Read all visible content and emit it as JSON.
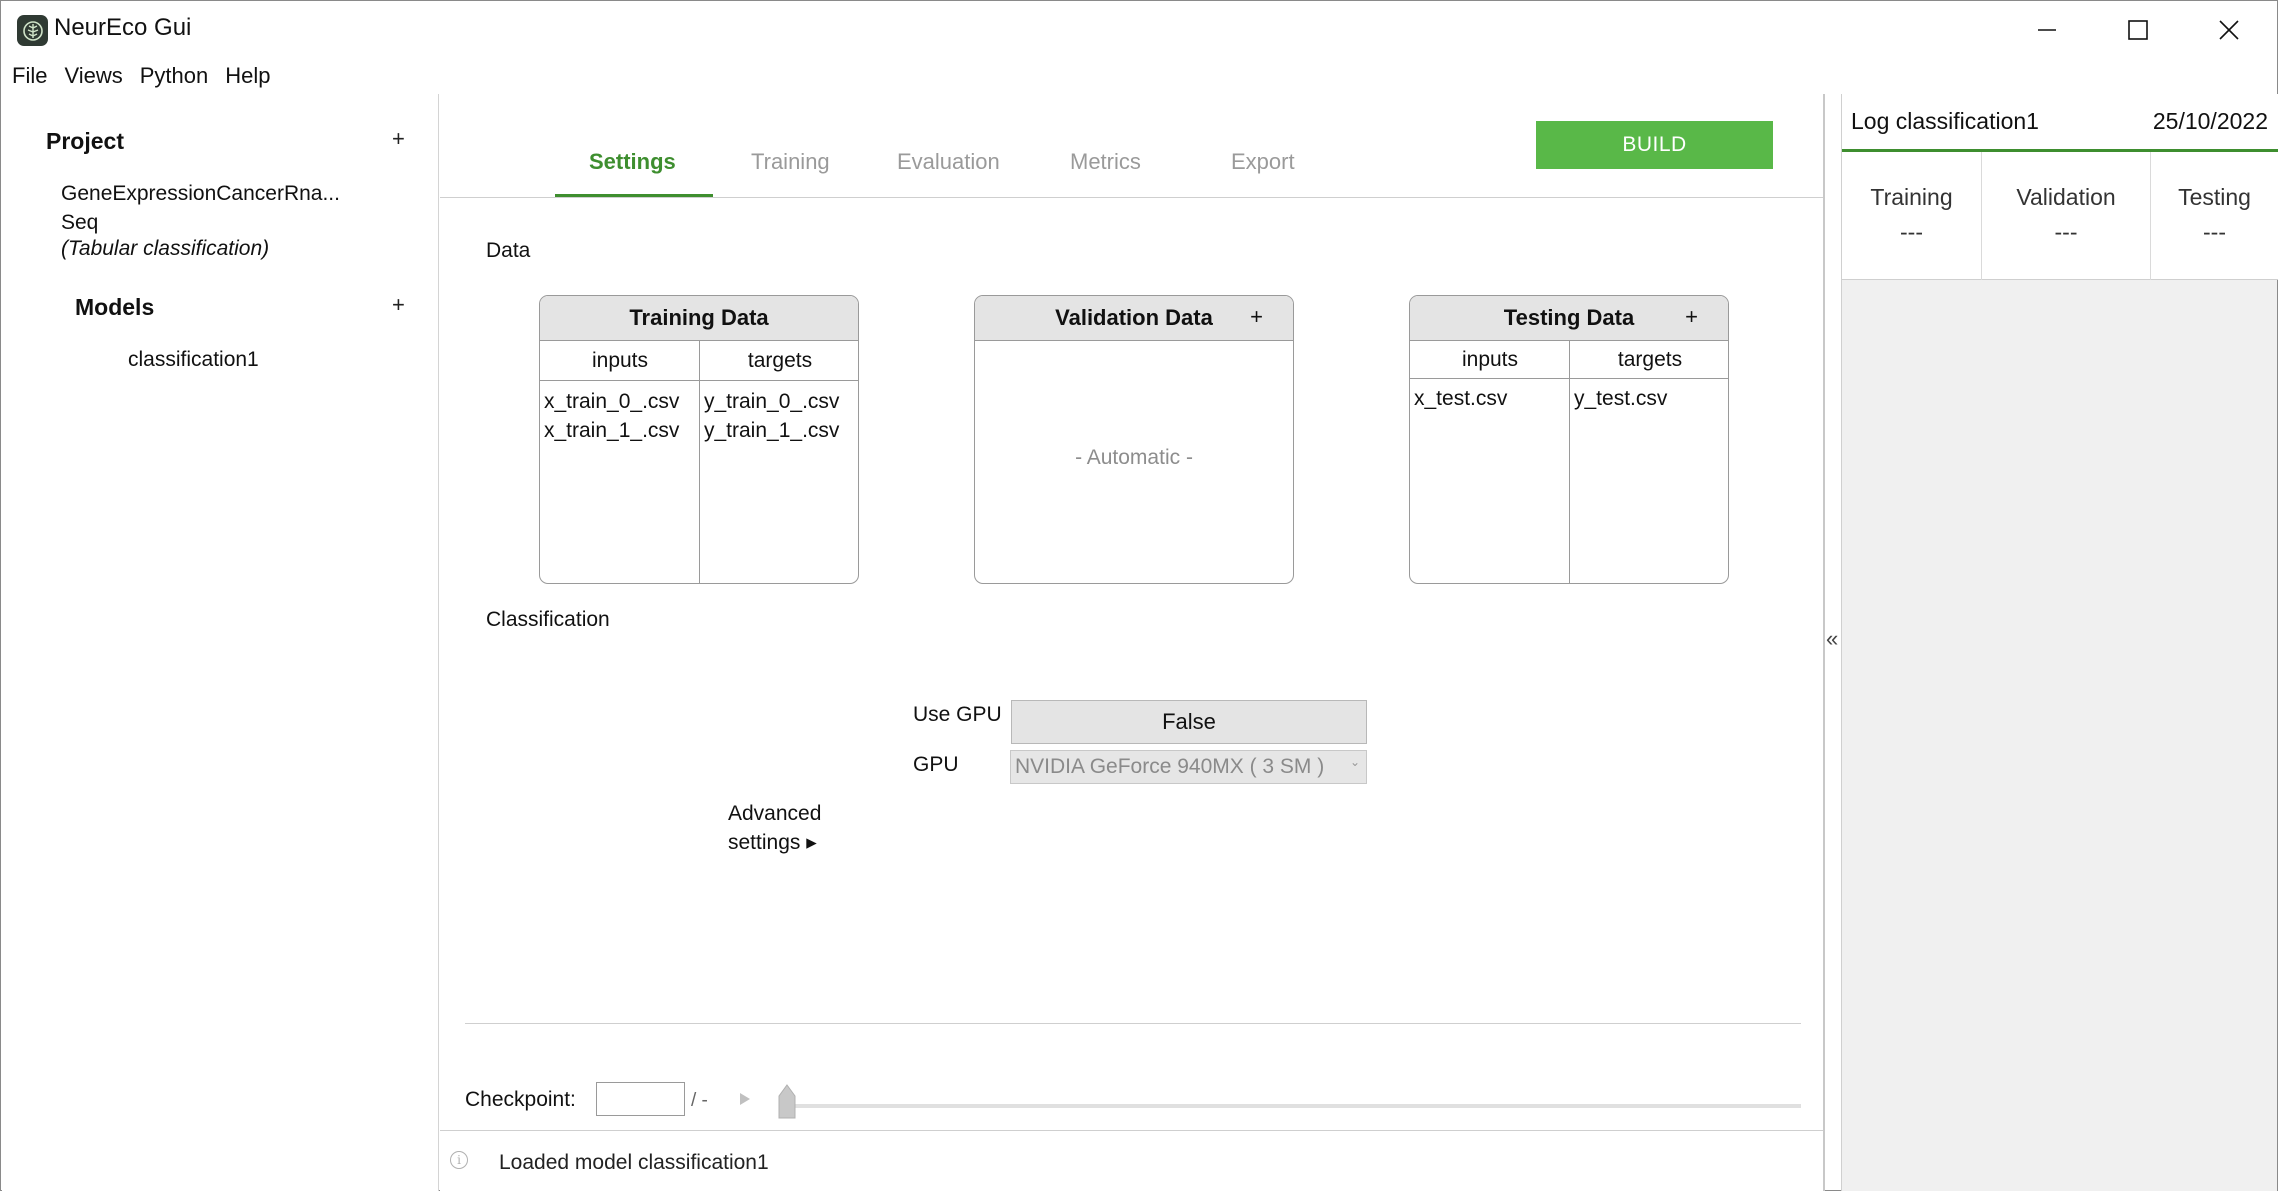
{
  "window": {
    "title": "NeurEco Gui"
  },
  "menu": {
    "items": [
      "File",
      "Views",
      "Python",
      "Help"
    ]
  },
  "sidebar": {
    "project_label": "Project",
    "project_add": "+",
    "project_name_line1": "GeneExpressionCancerRna...",
    "project_name_line2": "Seq",
    "project_type": "(Tabular classification)",
    "models_label": "Models",
    "models_add": "+",
    "model_item": "classification1"
  },
  "tabs": {
    "settings": "Settings",
    "training": "Training",
    "evaluation": "Evaluation",
    "metrics": "Metrics",
    "export": "Export",
    "active": "settings"
  },
  "build_button": "BUILD",
  "data_section": {
    "label": "Data",
    "training": {
      "title": "Training Data",
      "col_inputs": "inputs",
      "col_targets": "targets",
      "inputs": [
        "x_train_0_.csv",
        "x_train_1_.csv"
      ],
      "targets": [
        "y_train_0_.csv",
        "y_train_1_.csv"
      ]
    },
    "validation": {
      "title": "Validation Data",
      "add": "+",
      "placeholder": "- Automatic -"
    },
    "testing": {
      "title": "Testing Data",
      "add": "+",
      "col_inputs": "inputs",
      "col_targets": "targets",
      "inputs": [
        "x_test.csv"
      ],
      "targets": [
        "y_test.csv"
      ]
    }
  },
  "classification_section": {
    "label": "Classification",
    "use_gpu_label": "Use GPU",
    "use_gpu_value": "False",
    "gpu_label": "GPU",
    "gpu_value": "NVIDIA GeForce 940MX ( 3 SM )",
    "advanced_line1": "Advanced",
    "advanced_line2": "settings ▸"
  },
  "checkpoint": {
    "label": "Checkpoint:",
    "value": "",
    "total": "/ -"
  },
  "status": {
    "message": "Loaded model classification1"
  },
  "log": {
    "title": "Log classification1",
    "date": "25/10/2022",
    "columns": [
      {
        "head": "Training",
        "value": "---"
      },
      {
        "head": "Validation",
        "value": "---"
      },
      {
        "head": "Testing",
        "value": "---"
      }
    ]
  },
  "colors": {
    "accent": "#3e8e2f",
    "build": "#59b848"
  }
}
